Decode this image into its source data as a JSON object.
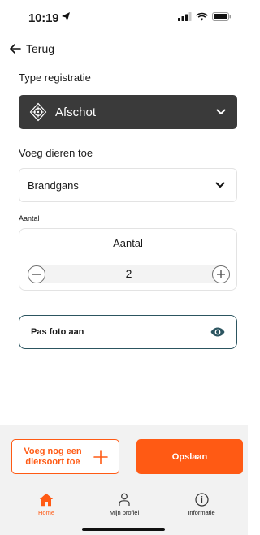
{
  "status_bar": {
    "time": "10:19"
  },
  "back": {
    "label": "Terug"
  },
  "type_section": {
    "label": "Type registratie",
    "selected": "Afschot",
    "icon": "crosshair-icon"
  },
  "animals_section": {
    "label": "Voeg dieren toe",
    "selected": "Brandgans"
  },
  "amount_section": {
    "label": "Aantal",
    "card_title": "Aantal",
    "value": "2"
  },
  "photo": {
    "label": "Pas foto aan",
    "icon": "eye-icon"
  },
  "actions": {
    "add_species_label": "Voeg nog een diersoort toe",
    "save_label": "Opslaan"
  },
  "tabs": [
    {
      "label": "Home",
      "icon": "home-icon",
      "active": true
    },
    {
      "label": "Mijn profiel",
      "icon": "user-icon",
      "active": false
    },
    {
      "label": "Informatie",
      "icon": "info-icon",
      "active": false
    }
  ],
  "colors": {
    "accent": "#ff5a14",
    "dark": "#3a3a3a",
    "photo_border": "#2c5560"
  }
}
